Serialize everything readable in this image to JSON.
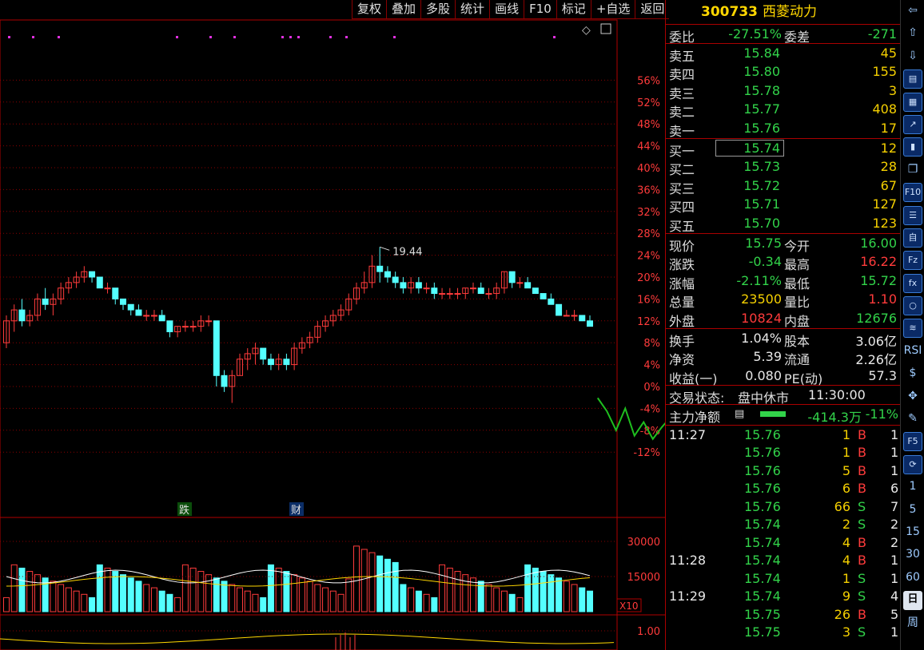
{
  "toolbar": {
    "items": [
      "复权",
      "叠加",
      "多股",
      "统计",
      "画线",
      "F10",
      "标记",
      "+自选",
      "返回"
    ]
  },
  "chart": {
    "max_price_label": "19.44",
    "pct_ticks": [
      "56%",
      "52%",
      "48%",
      "44%",
      "40%",
      "36%",
      "32%",
      "28%",
      "24%",
      "20%",
      "16%",
      "12%",
      "8%",
      "4%",
      "0%",
      "-4%",
      "-8%",
      "-12%"
    ],
    "event_tags": [
      "跌",
      "财"
    ],
    "volume_ticks": [
      "30000",
      "15000"
    ],
    "volume_unit": "X10",
    "indicator_tick": "1.00",
    "colors": {
      "up": "#ff3b3b",
      "down": "#54ffff",
      "grid": "#8a0000",
      "ma1": "#ffffff",
      "ma2": "#ffd700",
      "path": "#1fbf1f",
      "marker": "#e030e0"
    }
  },
  "chart_data": {
    "type": "candlestick",
    "title": "",
    "y_axis": {
      "unit": "%",
      "range": [
        -12,
        56
      ]
    },
    "volume": {
      "ticks": [
        30000,
        15000
      ]
    },
    "candles": [
      [
        8,
        13,
        7,
        12
      ],
      [
        12,
        15,
        10,
        14
      ],
      [
        14,
        16,
        11,
        12
      ],
      [
        12,
        14,
        11,
        13
      ],
      [
        13,
        17,
        12,
        16
      ],
      [
        16,
        18,
        14,
        15
      ],
      [
        15,
        17,
        13,
        16
      ],
      [
        16,
        19,
        15,
        18
      ],
      [
        18,
        20,
        17,
        19
      ],
      [
        19,
        21,
        18,
        20
      ],
      [
        20,
        22,
        19,
        21
      ],
      [
        21,
        21,
        19,
        20
      ],
      [
        20,
        20,
        18,
        18
      ],
      [
        18,
        19,
        17,
        18
      ],
      [
        18,
        18,
        15,
        16
      ],
      [
        16,
        16,
        14,
        15
      ],
      [
        15,
        15,
        13,
        14
      ],
      [
        14,
        15,
        13,
        13
      ],
      [
        13,
        14,
        12,
        13
      ],
      [
        13,
        14,
        12,
        13
      ],
      [
        13,
        14,
        12,
        12
      ],
      [
        12,
        12,
        9,
        10
      ],
      [
        10,
        11,
        9,
        11
      ],
      [
        11,
        12,
        10,
        11
      ],
      [
        11,
        12,
        10,
        11
      ],
      [
        11,
        13,
        10,
        12
      ],
      [
        12,
        13,
        11,
        12
      ],
      [
        12,
        12,
        0,
        2
      ],
      [
        2,
        3,
        -1,
        0
      ],
      [
        0,
        3,
        -3,
        2
      ],
      [
        2,
        6,
        2,
        5
      ],
      [
        5,
        7,
        3,
        6
      ],
      [
        6,
        8,
        4,
        7
      ],
      [
        7,
        7,
        4,
        5
      ],
      [
        5,
        6,
        3,
        4
      ],
      [
        4,
        6,
        3,
        5
      ],
      [
        5,
        6,
        3,
        4
      ],
      [
        4,
        8,
        3,
        7
      ],
      [
        7,
        9,
        6,
        8
      ],
      [
        8,
        10,
        7,
        9
      ],
      [
        9,
        12,
        8,
        11
      ],
      [
        11,
        13,
        10,
        12
      ],
      [
        12,
        14,
        11,
        13
      ],
      [
        13,
        15,
        12,
        14
      ],
      [
        14,
        17,
        13,
        16
      ],
      [
        16,
        19,
        15,
        18
      ],
      [
        18,
        21,
        17,
        19
      ],
      [
        19,
        24,
        18,
        22
      ],
      [
        22,
        25.5,
        19,
        21
      ],
      [
        21,
        22,
        19,
        20
      ],
      [
        20,
        21,
        18,
        19
      ],
      [
        19,
        20,
        17,
        18
      ],
      [
        18,
        20,
        17,
        19
      ],
      [
        19,
        20,
        17,
        18
      ],
      [
        18,
        19,
        17,
        18
      ],
      [
        18,
        19,
        16,
        17
      ],
      [
        17,
        18,
        16,
        17
      ],
      [
        17,
        18,
        16,
        17
      ],
      [
        17,
        18,
        16,
        17
      ],
      [
        17,
        18,
        16,
        18
      ],
      [
        18,
        19,
        17,
        18
      ],
      [
        18,
        19,
        17,
        17
      ],
      [
        17,
        18,
        16,
        17
      ],
      [
        17,
        19,
        16,
        18
      ],
      [
        18,
        21,
        17,
        21
      ],
      [
        21,
        21,
        18,
        19
      ],
      [
        19,
        20,
        18,
        19
      ],
      [
        19,
        20,
        18,
        18
      ],
      [
        18,
        18,
        17,
        17
      ],
      [
        17,
        17,
        16,
        16
      ],
      [
        16,
        17,
        15,
        15
      ],
      [
        15,
        15,
        13,
        13
      ],
      [
        13,
        14,
        13,
        13
      ],
      [
        13,
        14,
        12,
        13
      ],
      [
        13,
        13,
        12,
        12
      ],
      [
        12,
        13,
        11,
        11
      ]
    ],
    "intraday_pct": [
      -2.1,
      -4.5,
      -8.0,
      -4.0,
      -9.0,
      -6.5,
      -9.6,
      -7.4,
      -5.5,
      -6.0,
      -9.0,
      -12.0,
      -14.5
    ]
  },
  "quote": {
    "code": "300733",
    "name": "西菱动力",
    "weibi_label": "委比",
    "weibi": "-27.51%",
    "weicha_label": "委差",
    "weicha": "-271",
    "asks": [
      {
        "label": "卖五",
        "price": "15.84",
        "vol": "45"
      },
      {
        "label": "卖四",
        "price": "15.80",
        "vol": "155"
      },
      {
        "label": "卖三",
        "price": "15.78",
        "vol": "3"
      },
      {
        "label": "卖二",
        "price": "15.77",
        "vol": "408"
      },
      {
        "label": "卖一",
        "price": "15.76",
        "vol": "17"
      }
    ],
    "bids": [
      {
        "label": "买一",
        "price": "15.74",
        "vol": "12"
      },
      {
        "label": "买二",
        "price": "15.73",
        "vol": "28"
      },
      {
        "label": "买三",
        "price": "15.72",
        "vol": "67"
      },
      {
        "label": "买四",
        "price": "15.71",
        "vol": "127"
      },
      {
        "label": "买五",
        "price": "15.70",
        "vol": "123"
      }
    ],
    "stats": [
      {
        "l1": "现价",
        "v1": "15.75",
        "c1": "c-grn",
        "l2": "今开",
        "v2": "16.00",
        "c2": "c-grn"
      },
      {
        "l1": "涨跌",
        "v1": "-0.34",
        "c1": "c-grn",
        "l2": "最高",
        "v2": "16.22",
        "c2": "c-red"
      },
      {
        "l1": "涨幅",
        "v1": "-2.11%",
        "c1": "c-grn",
        "l2": "最低",
        "v2": "15.72",
        "c2": "c-grn"
      },
      {
        "l1": "总量",
        "v1": "23500",
        "c1": "c-yel",
        "l2": "量比",
        "v2": "1.10",
        "c2": "c-red"
      },
      {
        "l1": "外盘",
        "v1": "10824",
        "c1": "c-red",
        "l2": "内盘",
        "v2": "12676",
        "c2": "c-grn"
      }
    ],
    "stats2": [
      {
        "l1": "换手",
        "v1": "1.04%",
        "l2": "股本",
        "v2": "3.06亿"
      },
      {
        "l1": "净资",
        "v1": "5.39",
        "l2": "流通",
        "v2": "2.26亿"
      },
      {
        "l1": "收益(一)",
        "v1": "0.080",
        "l2": "PE(动)",
        "v2": "57.3"
      }
    ],
    "trade_status_label": "交易状态:",
    "trade_status": "盘中休市",
    "trade_time": "11:30:00",
    "main_flow_label": "主力净额",
    "main_flow": "-414.3万",
    "main_flow_pct": "-11%",
    "ticks": [
      {
        "time": "11:27",
        "price": "15.76",
        "vol": "1",
        "side": "B",
        "n": "1"
      },
      {
        "time": "",
        "price": "15.76",
        "vol": "1",
        "side": "B",
        "n": "1"
      },
      {
        "time": "",
        "price": "15.76",
        "vol": "5",
        "side": "B",
        "n": "1"
      },
      {
        "time": "",
        "price": "15.76",
        "vol": "6",
        "side": "B",
        "n": "6"
      },
      {
        "time": "",
        "price": "15.76",
        "vol": "66",
        "side": "S",
        "n": "7"
      },
      {
        "time": "",
        "price": "15.74",
        "vol": "2",
        "side": "S",
        "n": "2"
      },
      {
        "time": "",
        "price": "15.74",
        "vol": "4",
        "side": "B",
        "n": "2"
      },
      {
        "time": "11:28",
        "price": "15.74",
        "vol": "4",
        "side": "B",
        "n": "1"
      },
      {
        "time": "",
        "price": "15.74",
        "vol": "1",
        "side": "S",
        "n": "1"
      },
      {
        "time": "11:29",
        "price": "15.74",
        "vol": "9",
        "side": "S",
        "n": "4"
      },
      {
        "time": "",
        "price": "15.75",
        "vol": "26",
        "side": "B",
        "n": "5"
      },
      {
        "time": "",
        "price": "15.75",
        "vol": "3",
        "side": "S",
        "n": "1"
      }
    ]
  },
  "sidebar": {
    "items": [
      {
        "name": "arrow-left-icon",
        "g": "⇦",
        "t": "txt"
      },
      {
        "name": "arrow-up-icon",
        "g": "⇧",
        "t": "txt"
      },
      {
        "name": "arrow-down-icon",
        "g": "⇩",
        "t": "txt"
      },
      {
        "name": "report-icon",
        "g": "▤",
        "t": "box"
      },
      {
        "name": "table-icon",
        "g": "▦",
        "t": "box"
      },
      {
        "name": "line-chart-icon",
        "g": "↗",
        "t": "box"
      },
      {
        "name": "candle-icon",
        "g": "▮",
        "t": "box"
      },
      {
        "name": "copy-icon",
        "g": "❐",
        "t": "txt"
      },
      {
        "name": "f10-icon",
        "g": "F10",
        "t": "box"
      },
      {
        "name": "stack-icon",
        "g": "☰",
        "t": "box"
      },
      {
        "name": "self-select-icon",
        "g": "自",
        "t": "box"
      },
      {
        "name": "fz-icon",
        "g": "Fz",
        "t": "box"
      },
      {
        "name": "formula-icon",
        "g": "fx",
        "t": "box"
      },
      {
        "name": "circle-icon",
        "g": "○",
        "t": "box"
      },
      {
        "name": "wave-icon",
        "g": "≋",
        "t": "box"
      },
      {
        "name": "rsi-icon",
        "g": "RSI",
        "t": "txt"
      },
      {
        "name": "dollar-icon",
        "g": "$",
        "t": "txt"
      },
      {
        "name": "move-icon",
        "g": "✥",
        "t": "txt"
      },
      {
        "name": "pencil-icon",
        "g": "✎",
        "t": "txt"
      },
      {
        "name": "f5-icon",
        "g": "F5",
        "t": "box"
      },
      {
        "name": "refresh-icon",
        "g": "⟳",
        "t": "box"
      },
      {
        "name": "period-1",
        "g": "1",
        "t": "txt"
      },
      {
        "name": "period-5",
        "g": "5",
        "t": "txt"
      },
      {
        "name": "period-15",
        "g": "15",
        "t": "txt"
      },
      {
        "name": "period-30",
        "g": "30",
        "t": "txt"
      },
      {
        "name": "period-60",
        "g": "60",
        "t": "txt"
      },
      {
        "name": "period-day",
        "g": "日",
        "t": "sel"
      },
      {
        "name": "period-week",
        "g": "周",
        "t": "txt"
      }
    ]
  }
}
